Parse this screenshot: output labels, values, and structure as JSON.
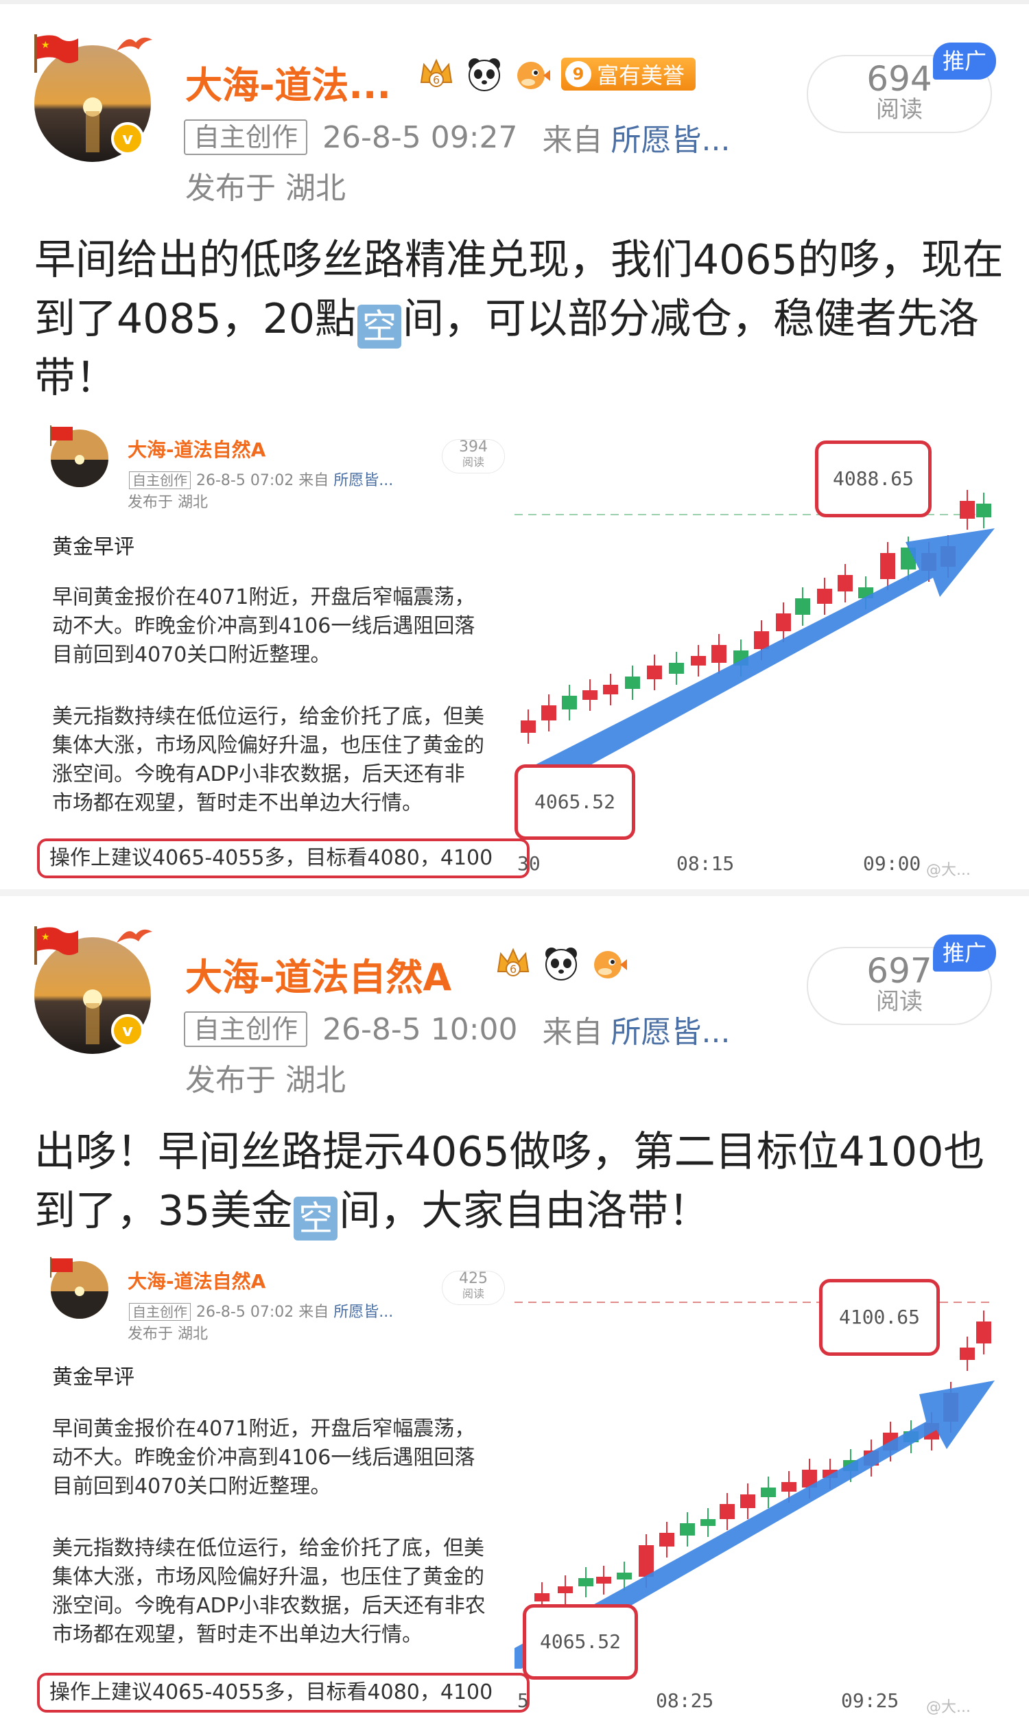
{
  "posts": [
    {
      "author": "大海-道法...",
      "honor_level": "9",
      "honor_label": "富有美誉",
      "badge_icons": [
        "crown-badge-icon",
        "panda-icon",
        "puffer-fish-icon"
      ],
      "tag": "自主创作",
      "time": "26-8-5 09:27",
      "from_label": "来自",
      "source": "所愿皆...",
      "location": "发布于 湖北",
      "reads": "694",
      "reads_label": "阅读",
      "ad_tag": "推广",
      "content_before": "早间给出的低哆丝路精准兑现，我们4065的哆，现在到了4085，20點",
      "kong": "空",
      "content_after": "间，可以部分减仓，稳健者先洛带！",
      "image": {
        "author": "大海-道法自然A",
        "tag": "自主创作",
        "time": "26-8-5 07:02",
        "from_label": "来自",
        "source": "所愿皆...",
        "location": "发布于 湖北",
        "reads": "394",
        "reads_label": "阅读",
        "title": "黄金早评",
        "para1": "早间黄金报价在4071附近，开盘后窄幅震荡，\n动不大。昨晚金价冲高到4106一线后遇阻回落\n目前回到4070关口附近整理。",
        "para2": "美元指数持续在低位运行，给金价托了底，但美\n集体大涨，市场风险偏好升温，也压住了黄金的\n涨空间。今晚有ADP小非农数据，后天还有非\n市场都在观望，暂时走不出单边大行情。",
        "op": "操作上建议4065-4055多，目标看4080，4100",
        "high_label": "4088.65",
        "low_label": "4065.52",
        "x_labels": [
          "30",
          "08:15",
          "09:00"
        ],
        "watermark": "@大..."
      }
    },
    {
      "author": "大海-道法自然A",
      "badge_icons": [
        "crown-badge-icon",
        "panda-icon",
        "puffer-fish-icon"
      ],
      "tag": "自主创作",
      "time": "26-8-5 10:00",
      "from_label": "来自",
      "source": "所愿皆...",
      "location": "发布于 湖北",
      "reads": "697",
      "reads_label": "阅读",
      "ad_tag": "推广",
      "content_before": "出哆！早间丝路提示4065做哆，第二目标位4100也到了，35美金",
      "kong": "空",
      "content_after": "间，大家自由洛带！",
      "image": {
        "author": "大海-道法自然A",
        "tag": "自主创作",
        "time": "26-8-5 07:02",
        "from_label": "来自",
        "source": "所愿皆...",
        "location": "发布于 湖北",
        "reads": "425",
        "reads_label": "阅读",
        "title": "黄金早评",
        "para1": "早间黄金报价在4071附近，开盘后窄幅震荡，\n动不大。昨晚金价冲高到4106一线后遇阻回落\n目前回到4070关口附近整理。",
        "para2": "美元指数持续在低位运行，给金价托了底，但美\n集体大涨，市场风险偏好升温，也压住了黄金的\n涨空间。今晚有ADP小非农数据，后天还有非农\n市场都在观望，暂时走不出单边大行情。",
        "op": "操作上建议4065-4055多，目标看4080，4100",
        "high_label": "4100.65",
        "low_label": "4065.52",
        "x_labels": [
          "5",
          "08:25",
          "09:25"
        ],
        "watermark": "@大..."
      }
    }
  ],
  "colors": {
    "up": "#e0333d",
    "down": "#2fae62",
    "arrow": "#3d86e3",
    "accent": "#f26a1b"
  }
}
